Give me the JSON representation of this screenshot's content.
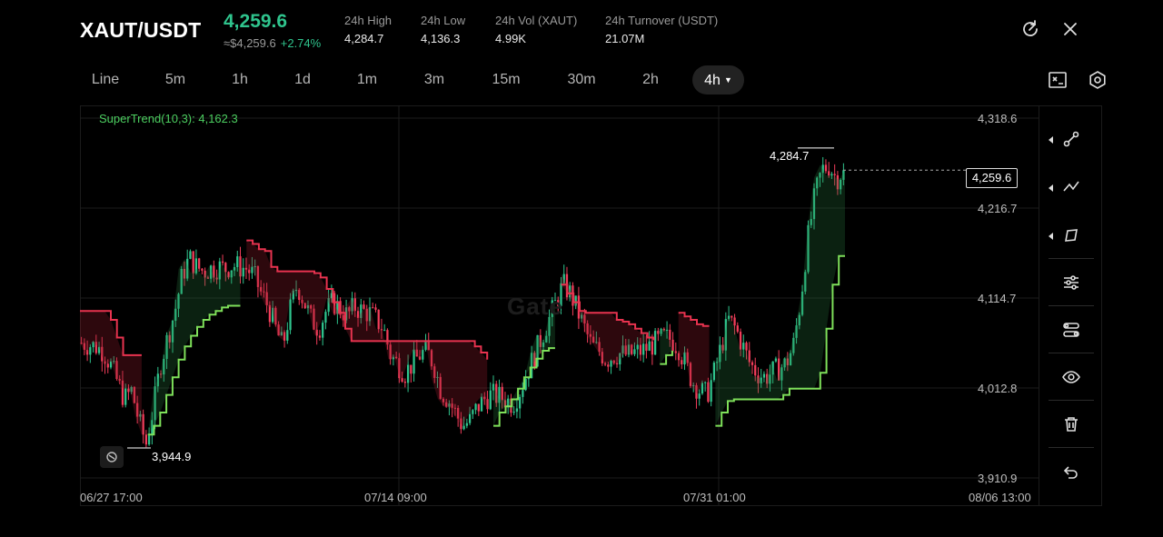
{
  "header": {
    "pair": "XAUT/USDT",
    "last_price": "4,259.6",
    "fiat_price": "≈$4,259.6",
    "change": "+2.74%",
    "stats": [
      {
        "label": "24h  High",
        "value": "4,284.7"
      },
      {
        "label": "24h  Low",
        "value": "4,136.3"
      },
      {
        "label": "24h  Vol (XAUT)",
        "value": "4.99K"
      },
      {
        "label": "24h  Turnover (USDT)",
        "value": "21.07M"
      }
    ],
    "icons": [
      "refresh-icon",
      "close-icon"
    ]
  },
  "toolbar": {
    "intervals": [
      "Line",
      "5m",
      "1h",
      "1d",
      "1m",
      "3m",
      "15m",
      "30m",
      "2h",
      "4h"
    ],
    "active_interval": "4h",
    "icons": [
      "chart-settings-icon",
      "gear-icon"
    ]
  },
  "side_tools": {
    "icons": [
      "line-tool-icon",
      "trend-tool-icon",
      "shape-tool-icon",
      "indicator-settings-icon",
      "indicator-toggle-icon",
      "visibility-icon",
      "trash-icon",
      "undo-icon"
    ]
  },
  "colors": {
    "up": "#2fc48d",
    "down": "#f23d5a",
    "trend_up": "#7ee05a",
    "trend_down": "#e8334f",
    "background": "#000000"
  },
  "chart_data": {
    "type": "candlestick",
    "indicator_label": "SuperTrend(10,3): 4,162.3",
    "y_ticks": [
      "4,318.6",
      "4,216.7",
      "4,114.7",
      "4,012.8",
      "3,910.9"
    ],
    "ylim": [
      3910.9,
      4318.6
    ],
    "x_ticks": [
      "06/27 17:00",
      "07/14 09:00",
      "07/31 01:00",
      "08/06 13:00"
    ],
    "current_price": "4,259.6",
    "high_marker": "4,284.7",
    "low_marker": "3,944.9",
    "watermark": "Gate",
    "close_path": [
      4064,
      4062,
      4060,
      4055,
      4040,
      4020,
      4000,
      4010,
      3975,
      3950,
      3990,
      4040,
      4070,
      4100,
      4140,
      4160,
      4150,
      4145,
      4148,
      4150,
      4148,
      4152,
      4150,
      4148,
      4140,
      4120,
      4105,
      4080,
      4060,
      4100,
      4130,
      4110,
      4090,
      4080,
      4100,
      4110,
      4102,
      4095,
      4105,
      4100,
      4098,
      4090,
      4080,
      4050,
      4040,
      4030,
      4040,
      4050,
      4055,
      4040,
      4010,
      4000,
      3985,
      3970,
      3975,
      3990,
      4000,
      4005,
      4003,
      4000,
      3995,
      4010,
      4030,
      4050,
      4070,
      4090,
      4110,
      4130,
      4120,
      4100,
      4080,
      4060,
      4055,
      4045,
      4050,
      4052,
      4050,
      4053,
      4055,
      4060,
      4065,
      4070,
      4068,
      4060,
      4040,
      4020,
      4010,
      4005,
      4030,
      4060,
      4090,
      4080,
      4060,
      4040,
      4030,
      4025,
      4030,
      4035,
      4040,
      4060,
      4110,
      4180,
      4230,
      4260,
      4265,
      4250,
      4259.6
    ],
    "supertrend": [
      {
        "dir": "down",
        "values": [
          4100,
          4100,
          4100,
          4100,
          4100,
          4090,
          4070,
          4050,
          4050,
          4050,
          4050
        ]
      },
      {
        "dir": "up",
        "values": [
          3960,
          3970,
          3985,
          4005,
          4025,
          4045,
          4060,
          4072,
          4082,
          4090,
          4096,
          4100,
          4104,
          4106,
          4106,
          4106
        ]
      },
      {
        "dir": "down",
        "values": [
          4180,
          4176,
          4170,
          4168,
          4150,
          4145,
          4145,
          4145,
          4145,
          4145,
          4145,
          4143,
          4138,
          4125,
          4110,
          4098,
          4080,
          4066,
          4066,
          4066,
          4066,
          4066,
          4066,
          4066,
          4066,
          4066,
          4066,
          4066,
          4066,
          4066,
          4066,
          4066,
          4066,
          4066,
          4066,
          4066,
          4066,
          4060,
          4053,
          4045
        ]
      },
      {
        "dir": "up",
        "values": [
          3970,
          3985,
          3992,
          4000,
          4012,
          4025,
          4036,
          4046,
          4055,
          4058,
          4058
        ]
      },
      {
        "dir": "down",
        "values": [
          4130,
          4120,
          4110,
          4100,
          4098,
          4098,
          4098,
          4098,
          4098,
          4090,
          4088,
          4085,
          4080,
          4075,
          4070,
          4067
        ]
      },
      {
        "dir": "up",
        "values": [
          4040,
          4050,
          4055
        ]
      },
      {
        "dir": "down",
        "values": [
          4098,
          4094,
          4090,
          4085,
          4083,
          4083
        ]
      },
      {
        "dir": "up",
        "values": [
          3970,
          3985,
          3998,
          4000,
          4000,
          4000,
          4000,
          4000,
          4000,
          4000,
          4000,
          4005,
          4012,
          4012,
          4012,
          4012,
          4012,
          4030,
          4080,
          4130,
          4162.3,
          4162.3
        ]
      }
    ]
  }
}
